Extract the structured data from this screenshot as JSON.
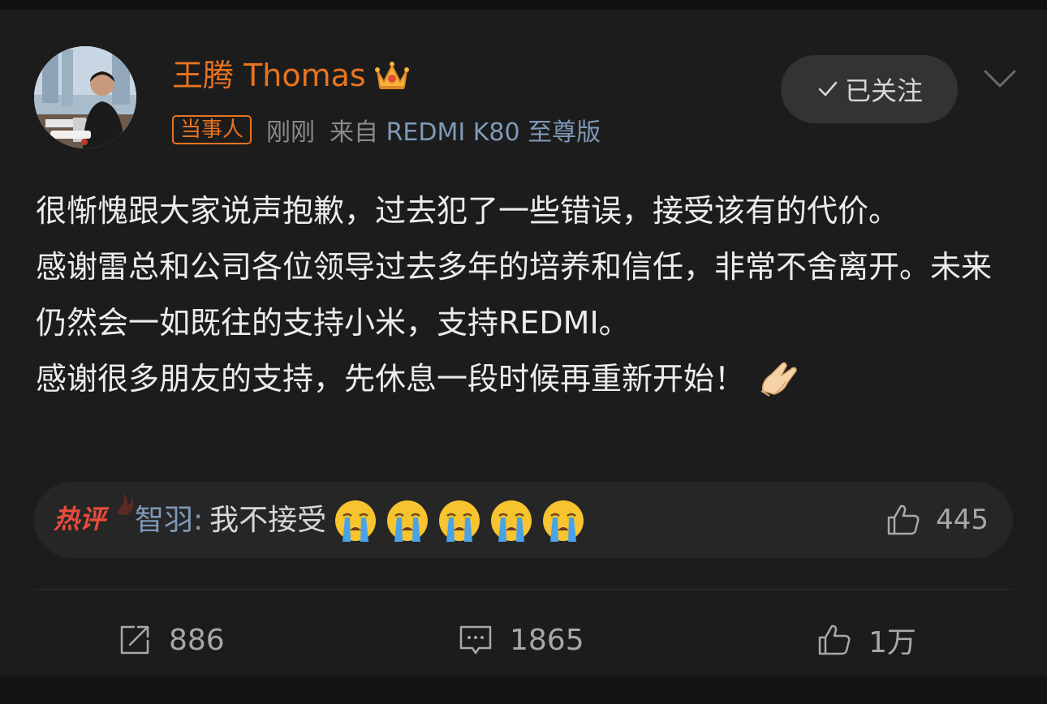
{
  "post": {
    "author": "王腾 Thomas",
    "tag": "当事人",
    "time": "刚刚",
    "source_prefix": "来自",
    "device": "REDMI K80 至尊版",
    "follow_label": "已关注",
    "paragraphs": [
      "很惭愧跟大家说声抱歉，过去犯了一些错误，接受该有的代价。",
      "感谢雷总和公司各位领导过去多年的培养和信任，非常不舍离开。未来仍然会一如既往的支持小米，支持REDMI。",
      "感谢很多朋友的支持，先休息一段时候再重新开始！"
    ]
  },
  "hot_comment": {
    "badge": "热评",
    "author": "智羽",
    "colon": ":",
    "text": "我不接受",
    "emoji_count": 5,
    "likes": "445"
  },
  "actions": {
    "reposts": "886",
    "comments": "1865",
    "likes": "1万"
  },
  "colors": {
    "accent": "#e8731f",
    "link": "#7f99b8",
    "hot": "#e84b3a",
    "background": "#1c1c1c"
  }
}
